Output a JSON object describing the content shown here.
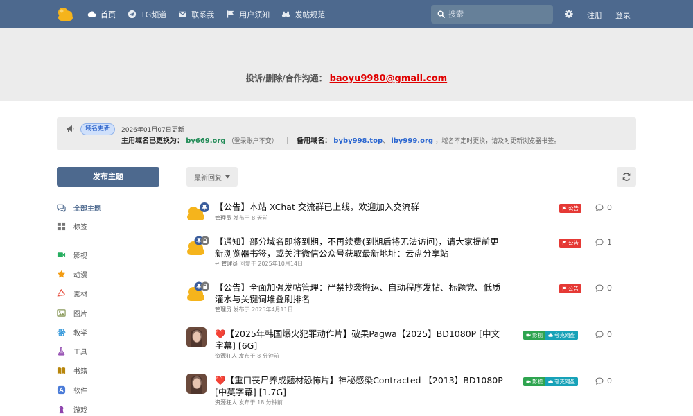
{
  "header": {
    "nav": [
      {
        "label": "首页",
        "icon": "cloud-icon",
        "active": true
      },
      {
        "label": "TG频道",
        "icon": "telegram-icon"
      },
      {
        "label": "联系我",
        "icon": "envelope-icon"
      },
      {
        "label": "用户须知",
        "icon": "flag-icon"
      },
      {
        "label": "发帖规范",
        "icon": "binoculars-icon"
      }
    ],
    "search_placeholder": "搜索",
    "register": "注册",
    "login": "登录"
  },
  "hero": {
    "prefix": "投诉/删除/合作沟通：",
    "email": "baoyu9980@gmail.com"
  },
  "notice": {
    "badge": "域名更新",
    "date": "2026年01月07日更新",
    "main_label": "主用域名已更换为：",
    "main_domain": "by669.org",
    "main_note": "（登录账户不变）",
    "sep": "｜",
    "backup_label": "备用域名：",
    "backup_1": "byby998.top",
    "backup_sep": "、",
    "backup_2": "iby999.org",
    "backup_note": "，域名不定时更换，请及时更新浏览器书签。"
  },
  "sidebar": {
    "post_button": "发布主题",
    "items": [
      {
        "label": "全部主题",
        "icon": "comments-icon",
        "color": "#4d698e",
        "active": true
      },
      {
        "label": "标签",
        "icon": "grid-icon",
        "color": "#777777"
      },
      {
        "label": "影视",
        "icon": "video-icon",
        "color": "#27ae60"
      },
      {
        "label": "动漫",
        "icon": "star-icon",
        "color": "#f39c12"
      },
      {
        "label": "素材",
        "icon": "recycle-icon",
        "color": "#e74c3c"
      },
      {
        "label": "图片",
        "icon": "image-icon",
        "color": "#8a9a5b"
      },
      {
        "label": "教学",
        "icon": "atom-icon",
        "color": "#3498db"
      },
      {
        "label": "工具",
        "icon": "flask-icon",
        "color": "#9b59b6"
      },
      {
        "label": "书籍",
        "icon": "book-icon",
        "color": "#b8860b"
      },
      {
        "label": "软件",
        "icon": "appstore-icon",
        "color": "#4a7bd8"
      },
      {
        "label": "游戏",
        "icon": "chess-icon",
        "color": "#8e44ad"
      }
    ]
  },
  "toolbar": {
    "sort_label": "最新回复"
  },
  "discussions": [
    {
      "title": "【公告】本站 XChat 交流群已上线，欢迎加入交流群",
      "author": "管理员",
      "action": "发布于",
      "time": "8 天前",
      "avatar": "cloud-avatar",
      "badges": [
        "pin",
        "lock"
      ],
      "tags": [
        {
          "label": "公告",
          "color": "red"
        }
      ],
      "replies": "0"
    },
    {
      "title": "【通知】部分域名即将到期，不再续费(到期后将无法访问)，请大家提前更新浏览器书签，或关注微信公众号获取最新地址：云盘分享站",
      "author": "管理员",
      "action": "回复于",
      "time": "2025年10月14日",
      "avatar": "cloud-avatar",
      "badges": [
        "pin",
        "lock"
      ],
      "reply_icon": true,
      "tags": [
        {
          "label": "公告",
          "color": "red"
        }
      ],
      "replies": "1"
    },
    {
      "title": "【公告】全面加强发帖管理：严禁抄袭搬运、自动程序发帖、标题党、低质灌水与关键词堆叠刷排名",
      "author": "管理员",
      "action": "发布于",
      "time": "2025年4月11日",
      "avatar": "cloud-avatar",
      "badges": [
        "pin",
        "lock"
      ],
      "tags": [
        {
          "label": "公告",
          "color": "red"
        }
      ],
      "replies": "0"
    },
    {
      "title": "❤️【2025年韩国爆火犯罪动作片】破果Pagwa【2025】BD1080P [中文字幕] [6G]",
      "author": "资源狂人",
      "action": "发布于",
      "time": "8 分钟前",
      "avatar": "photo-avatar",
      "badges": [],
      "tags": [
        {
          "label": "影视",
          "color": "green"
        },
        {
          "label": "夸克网盘",
          "color": "teal"
        }
      ],
      "replies": "0"
    },
    {
      "title": "❤️【重口丧尸养成题材恐怖片】神秘感染Contracted 【2013】BD1080P [中英字幕] [1.7G]",
      "author": "资源狂人",
      "action": "发布于",
      "time": "18 分钟前",
      "avatar": "photo-avatar",
      "badges": [],
      "tags": [
        {
          "label": "影视",
          "color": "green"
        },
        {
          "label": "夸克网盘",
          "color": "teal"
        }
      ],
      "replies": "0"
    }
  ]
}
